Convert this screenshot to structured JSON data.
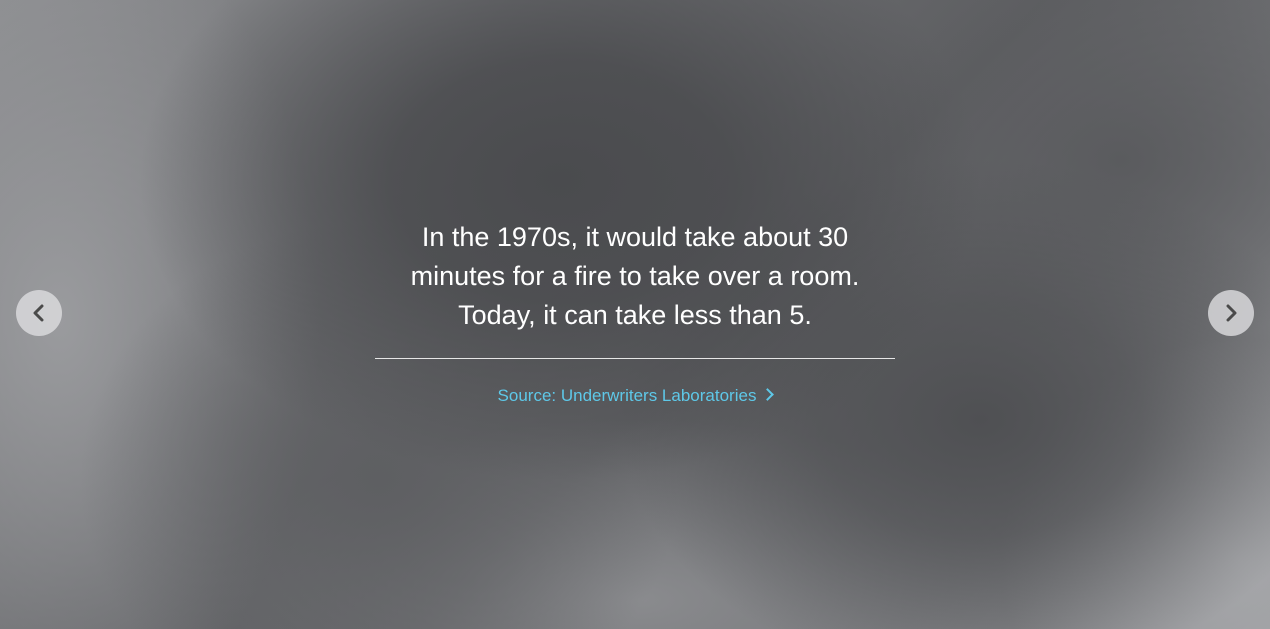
{
  "quote": {
    "line1": "In the 1970s, it would take about 30",
    "line2": "minutes for a fire to take over a room.",
    "line3": "Today, it can take less than 5."
  },
  "source": {
    "label": "Source: Underwriters Laboratories"
  },
  "nav": {
    "prev_icon": "chevron-left-icon",
    "next_icon": "chevron-right-icon"
  },
  "colors": {
    "link": "#5ec8e8",
    "quote_text": "#ffffff",
    "nav_button_bg": "#dcdcde",
    "nav_chevron": "#4a4a4a"
  }
}
